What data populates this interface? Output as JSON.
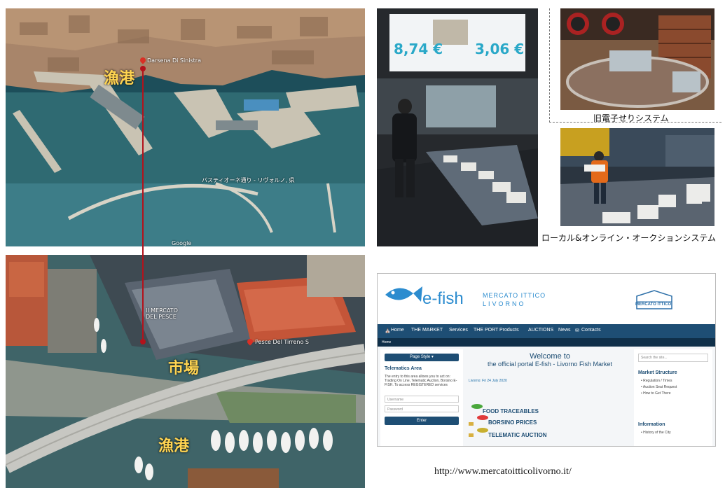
{
  "labels": {
    "fishing_port": "漁港",
    "market": "市場",
    "fishing_port_2": "漁港",
    "old_system_caption": "旧電子せりシステム",
    "local_online_caption": "ローカル&オンライン・オークションシステム"
  },
  "map_labels": {
    "google": "Google",
    "mercato_del_pesce": "Il MERCATO DEL PESCE",
    "pesce_del_tirreno": "Pesce Del Tirreno S",
    "darsena": "Darsena Di Sinistra",
    "bastione": "バスティオーネ通り - リヴォルノ, 県"
  },
  "display_prices": [
    "8,74 €",
    "3,06 €"
  ],
  "website": {
    "logo_text": "e-fish",
    "logo_sub_top": "MERCATO ITTICO",
    "logo_sub_bottom": "LIVORNO",
    "right_logo": "MERCATO ITTICO",
    "nav": [
      "Home",
      "THE MARKET",
      "Services",
      "THE PORT",
      "Products",
      "AUCTIONS",
      "News",
      "Contacts"
    ],
    "breadcrumb": "Home",
    "page_style_button": "Page Style",
    "telematics_title": "Telematics Area",
    "telematics_text": "The entry to this area allows you to act on: Trading On Line, Telematic Auction, Borsino E-FISH. To access REGISTERED services",
    "registered_link": "REGISTERED",
    "username_placeholder": "Username",
    "password_placeholder": "Password",
    "enter_button": "Enter",
    "welcome_1": "Welcome to",
    "welcome_2": "the official portal E-fish - Livorno Fish Market",
    "date": "Livorno: Fri 24 July 2020",
    "links": [
      "FOOD TRACEABLES",
      "BORSINO PRICES",
      "TELEMATIC AUCTION"
    ],
    "search_placeholder": "Search the site...",
    "structure_title": "Market Structure",
    "structure_items": [
      "Regulation / Times",
      "Auction Seat Request",
      "How to Get There"
    ],
    "info_title": "Information",
    "info_items": [
      "History of the City"
    ]
  },
  "url": "http://www.mercatoitticolivorno.it/",
  "colors": {
    "nav": "#1e4e74",
    "connector": "#b3121b",
    "label_yellow": "#ffd451"
  }
}
